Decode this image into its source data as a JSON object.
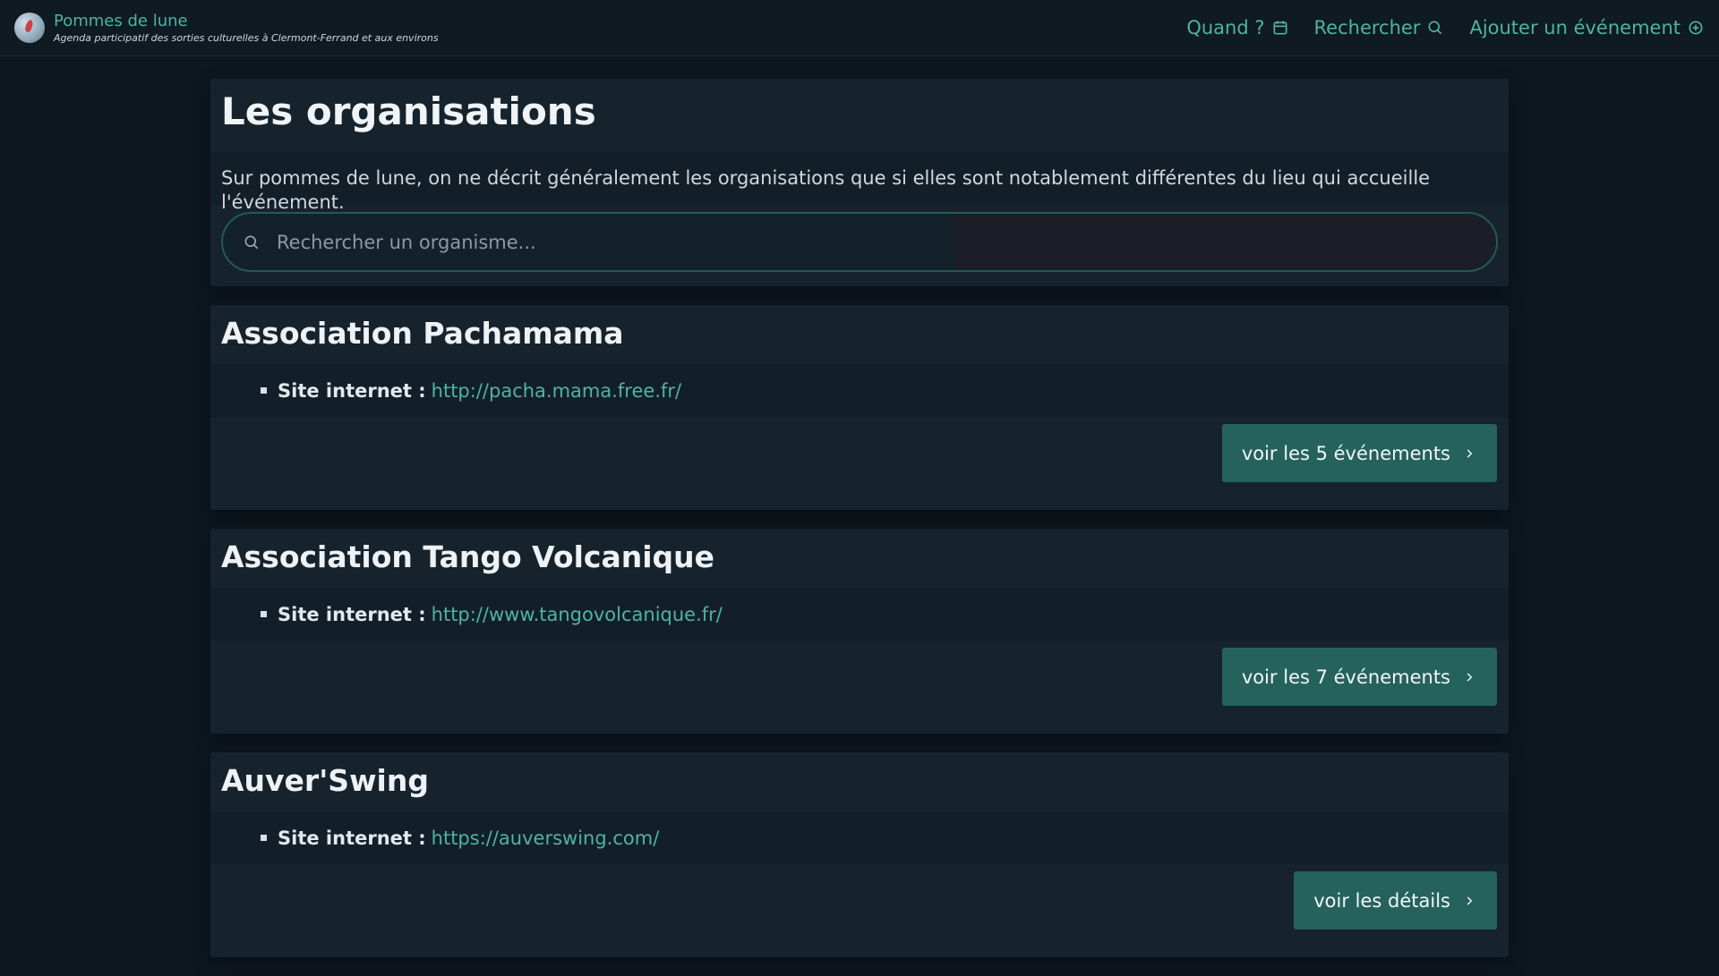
{
  "header": {
    "brand_name": "Pommes de lune",
    "tagline": "Agenda participatif des sorties culturelles à Clermont-Ferrand et aux environs",
    "nav": {
      "when": "Quand ?",
      "search": "Rechercher",
      "add_event": "Ajouter un événement"
    }
  },
  "main": {
    "title": "Les organisations",
    "intro": "Sur pommes de lune, on ne décrit généralement les organisations que si elles sont notablement différentes du lieu qui accueille l'événement.",
    "search_placeholder": "Rechercher un organisme..."
  },
  "organizations": [
    {
      "name": "Association Pachamama",
      "website_label": "Site internet :",
      "website": "http://pacha.mama.free.fr/",
      "button": "voir les 5 événements"
    },
    {
      "name": "Association Tango Volcanique",
      "website_label": "Site internet :",
      "website": "http://www.tangovolcanique.fr/",
      "button": "voir les 7 événements"
    },
    {
      "name": "Auver'Swing",
      "website_label": "Site internet :",
      "website": "https://auverswing.com/",
      "button": "voir les détails"
    }
  ],
  "colors": {
    "accent": "#4fb3a4",
    "button": "#25625c",
    "background": "#0d1720",
    "panel": "#16232d"
  },
  "icons": {
    "calendar": "calendar-icon",
    "search": "search-icon",
    "add": "plus-circle-icon",
    "chevron": "chevron-right-icon"
  }
}
